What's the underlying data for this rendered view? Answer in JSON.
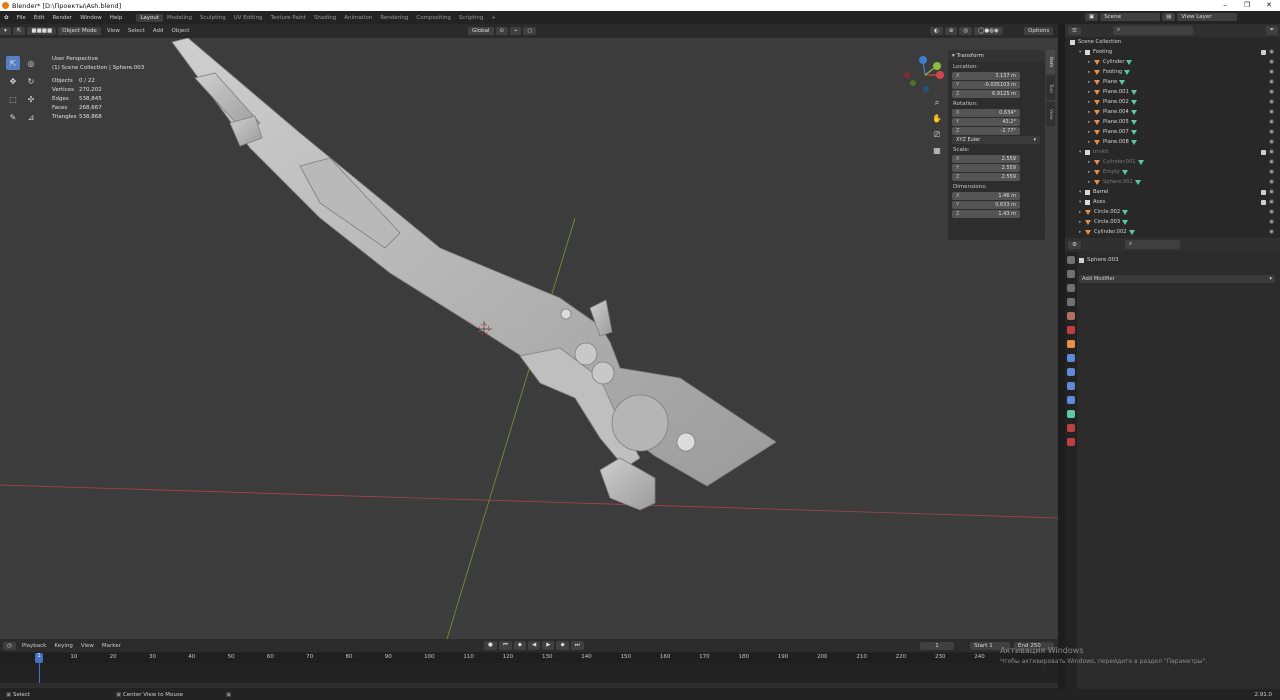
{
  "title": "Blender* [D:\\Проекты\\Ash.blend]",
  "menu": [
    "File",
    "Edit",
    "Render",
    "Window",
    "Help"
  ],
  "workspaces": [
    "Layout",
    "Modeling",
    "Sculpting",
    "UV Editing",
    "Texture Paint",
    "Shading",
    "Animation",
    "Rendering",
    "Compositing",
    "Scripting"
  ],
  "active_workspace": "Layout",
  "scene": "Scene",
  "view_layer": "View Layer",
  "header": {
    "mode": "Object Mode",
    "view": "View",
    "select": "Select",
    "add": "Add",
    "object": "Object",
    "orientation": "Global",
    "options": "Options"
  },
  "overlay": {
    "perspective": "User Perspective",
    "collection": "(1) Scene Collection | Sphere.003"
  },
  "stats": [
    {
      "k": "Objects",
      "v": "0 / 22"
    },
    {
      "k": "Vertices",
      "v": "270,202"
    },
    {
      "k": "Edges",
      "v": "538,845"
    },
    {
      "k": "Faces",
      "v": "268,667"
    },
    {
      "k": "Triangles",
      "v": "538,868"
    }
  ],
  "transform": {
    "title": "Transform",
    "location_label": "Location:",
    "location": [
      "3.137 m",
      "-0.035103 m",
      "6.9125 m"
    ],
    "rotation_label": "Rotation:",
    "rotation": [
      "0.634°",
      "43.2°",
      "-2.77°"
    ],
    "euler": "XYZ Euler",
    "scale_label": "Scale:",
    "scale": [
      "2.559",
      "2.559",
      "2.559"
    ],
    "dimensions_label": "Dimensions:",
    "dimensions": [
      "1.46 m",
      "0.633 m",
      "1.43 m"
    ],
    "axes": [
      "X",
      "Y",
      "Z"
    ]
  },
  "ntabs": [
    "Item",
    "Tool",
    "View"
  ],
  "outliner": {
    "root": "Scene Collection",
    "rows": [
      {
        "label": "Footing",
        "type": "coll",
        "indent": 1,
        "dim": false
      },
      {
        "label": "Cylinder",
        "type": "obj",
        "indent": 2,
        "dim": false
      },
      {
        "label": "Footing",
        "type": "obj",
        "indent": 2,
        "dim": false
      },
      {
        "label": "Plane",
        "type": "obj",
        "indent": 2,
        "dim": false
      },
      {
        "label": "Plane.001",
        "type": "obj",
        "indent": 2,
        "dim": false
      },
      {
        "label": "Plane.002",
        "type": "obj",
        "indent": 2,
        "dim": false
      },
      {
        "label": "Plane.004",
        "type": "obj",
        "indent": 2,
        "dim": false
      },
      {
        "label": "Plane.005",
        "type": "obj",
        "indent": 2,
        "dim": false
      },
      {
        "label": "Plane.007",
        "type": "obj",
        "indent": 2,
        "dim": false
      },
      {
        "label": "Plane.008",
        "type": "obj",
        "indent": 2,
        "dim": false
      },
      {
        "label": "trinkit",
        "type": "coll",
        "indent": 1,
        "dim": true
      },
      {
        "label": "Cylinder.001",
        "type": "obj",
        "indent": 2,
        "dim": true
      },
      {
        "label": "Empty",
        "type": "obj",
        "indent": 2,
        "dim": true
      },
      {
        "label": "Sphere.001",
        "type": "obj",
        "indent": 2,
        "dim": true
      },
      {
        "label": "Barrel",
        "type": "coll",
        "indent": 1,
        "dim": false
      },
      {
        "label": "Aces",
        "type": "coll",
        "indent": 1,
        "dim": false
      },
      {
        "label": "Circle.002",
        "type": "obj",
        "indent": 1,
        "dim": false
      },
      {
        "label": "Circle.003",
        "type": "obj",
        "indent": 1,
        "dim": false
      },
      {
        "label": "Cylinder.002",
        "type": "obj",
        "indent": 1,
        "dim": false
      }
    ]
  },
  "properties": {
    "object": "Sphere.003",
    "add_modifier": "Add Modifier"
  },
  "timeline": {
    "menus": [
      "Playback",
      "Keying",
      "View",
      "Marker"
    ],
    "ticks": [
      "1",
      "10",
      "20",
      "30",
      "40",
      "50",
      "60",
      "70",
      "80",
      "90",
      "100",
      "110",
      "120",
      "130",
      "140",
      "150",
      "160",
      "170",
      "180",
      "190",
      "200",
      "210",
      "220",
      "230",
      "240"
    ],
    "current_frame": "1",
    "start_label": "Start",
    "start": "1",
    "end_label": "End",
    "end": "250"
  },
  "status": {
    "select": "Select",
    "center": "Center View to Mouse",
    "version": "2.91.0"
  },
  "win_activation": {
    "line1": "Активация Windows",
    "line2": "Чтобы активировать Windows, перейдите в раздел \"Параметры\"."
  }
}
